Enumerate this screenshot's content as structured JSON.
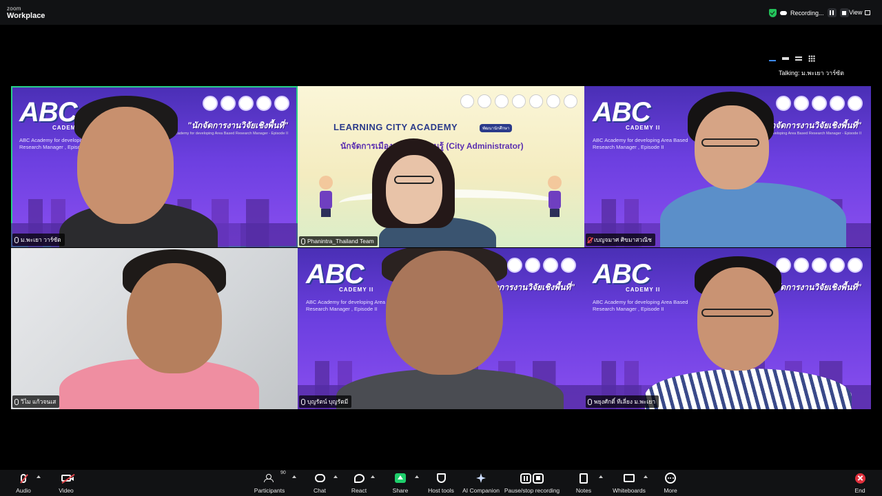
{
  "app": {
    "brand_top": "zoom",
    "brand_bottom": "Workplace"
  },
  "recording": {
    "label": "Recording..."
  },
  "view": {
    "label": "View"
  },
  "talking": {
    "label": "Talking: ม.พะเยา วาร์ซัต"
  },
  "slides": {
    "abc_logo": "ABC",
    "abc_sub": "CADEMY II",
    "abc_desc": "ABC Academy for developing Area Based Research Manager , Episode II",
    "headline": "\"นักจัดการงานวิจัยเชิงพื้นที่\"",
    "headline_small": "ABC Academy for developing Area Based Research Manager - Episode II",
    "city_title": "LEARNING CITY ACADEMY",
    "city_tag": "พัฒนานักศึกษา",
    "city_sub": "นักจัดการเมืองแห่งการเรียนรู้ (City Administrator)"
  },
  "participants": [
    {
      "name": "ม.พะเยา วาร์ซัต",
      "muted": false,
      "active": true
    },
    {
      "name": "Phanintra_Thailand Team",
      "muted": false,
      "active": false
    },
    {
      "name": "เบญจมาศ ศิขมาสวณิช",
      "muted": true,
      "active": false
    },
    {
      "name": "วิไม แก้วจนเส",
      "muted": false,
      "active": false
    },
    {
      "name": "บุญรัตน์ บุญรัตมี",
      "muted": false,
      "active": false
    },
    {
      "name": "พยุงศักดิ์ ทีเลี่ยง ม.พะเยา",
      "muted": false,
      "active": false
    }
  ],
  "toolbar": {
    "audio": "Audio",
    "video": "Video",
    "participants": "Participants",
    "participants_count": "90",
    "chat": "Chat",
    "react": "React",
    "share": "Share",
    "host_tools": "Host tools",
    "ai_companion": "AI Companion",
    "pause_stop": "Pause/stop recording",
    "notes": "Notes",
    "whiteboards": "Whiteboards",
    "more": "More",
    "end": "End"
  },
  "colors": {
    "active_speaker": "#29d08a",
    "share_green": "#1fcf6c",
    "end_red": "#e02f3c",
    "slide_purple": "#6c3fe0"
  }
}
